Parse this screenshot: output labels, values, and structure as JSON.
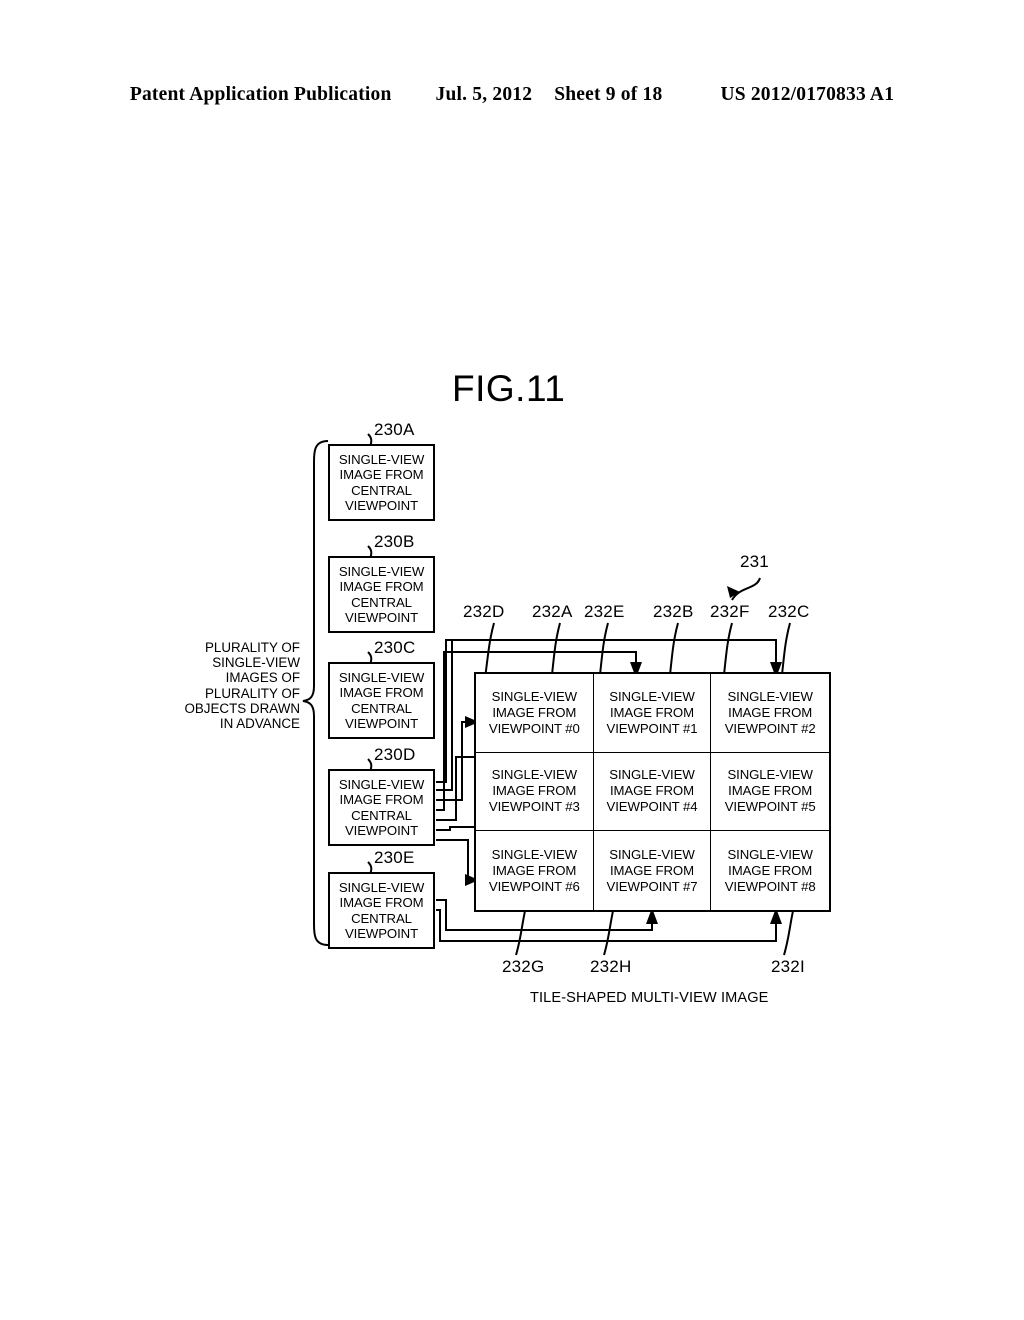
{
  "header": {
    "publication": "Patent Application Publication",
    "date": "Jul. 5, 2012",
    "sheet": "Sheet 9 of 18",
    "patent_number": "US 2012/0170833 A1"
  },
  "figure": {
    "title": "FIG.11",
    "bottom_caption": "TILE-SHAPED MULTI-VIEW IMAGE"
  },
  "bracket": {
    "caption_lines": [
      "PLURALITY OF",
      "SINGLE-VIEW",
      "IMAGES OF",
      "PLURALITY OF",
      "OBJECTS DRAWN",
      "IN ADVANCE"
    ]
  },
  "source_boxes": [
    {
      "ref": "230A",
      "lines": [
        "SINGLE-VIEW",
        "IMAGE FROM",
        "CENTRAL",
        "VIEWPOINT"
      ]
    },
    {
      "ref": "230B",
      "lines": [
        "SINGLE-VIEW",
        "IMAGE FROM",
        "CENTRAL",
        "VIEWPOINT"
      ]
    },
    {
      "ref": "230C",
      "lines": [
        "SINGLE-VIEW",
        "IMAGE FROM",
        "CENTRAL",
        "VIEWPOINT"
      ]
    },
    {
      "ref": "230D",
      "lines": [
        "SINGLE-VIEW",
        "IMAGE FROM",
        "CENTRAL",
        "VIEWPOINT"
      ]
    },
    {
      "ref": "230E",
      "lines": [
        "SINGLE-VIEW",
        "IMAGE FROM",
        "CENTRAL",
        "VIEWPOINT"
      ]
    }
  ],
  "tile_image": {
    "ref": "231",
    "cells": [
      {
        "ref": "232A",
        "lines": [
          "SINGLE-VIEW",
          "IMAGE FROM",
          "VIEWPOINT #0"
        ]
      },
      {
        "ref": "232B",
        "lines": [
          "SINGLE-VIEW",
          "IMAGE FROM",
          "VIEWPOINT #1"
        ]
      },
      {
        "ref": "232C",
        "lines": [
          "SINGLE-VIEW",
          "IMAGE FROM",
          "VIEWPOINT #2"
        ]
      },
      {
        "ref": "232D",
        "lines": [
          "SINGLE-VIEW",
          "IMAGE FROM",
          "VIEWPOINT #3"
        ]
      },
      {
        "ref": "232E",
        "lines": [
          "SINGLE-VIEW",
          "IMAGE FROM",
          "VIEWPOINT #4"
        ]
      },
      {
        "ref": "232F",
        "lines": [
          "SINGLE-VIEW",
          "IMAGE FROM",
          "VIEWPOINT #5"
        ]
      },
      {
        "ref": "232G",
        "lines": [
          "SINGLE-VIEW",
          "IMAGE FROM",
          "VIEWPOINT #6"
        ]
      },
      {
        "ref": "232H",
        "lines": [
          "SINGLE-VIEW",
          "IMAGE FROM",
          "VIEWPOINT #7"
        ]
      },
      {
        "ref": "232I",
        "lines": [
          "SINGLE-VIEW",
          "IMAGE FROM",
          "VIEWPOINT #8"
        ]
      }
    ]
  },
  "top_ref_labels": [
    "232D",
    "232A",
    "232E",
    "232B",
    "232F",
    "232C"
  ],
  "bottom_ref_labels": [
    "232G",
    "232H",
    "232I"
  ],
  "colors": {
    "ink": "#000000",
    "paper": "#ffffff"
  }
}
